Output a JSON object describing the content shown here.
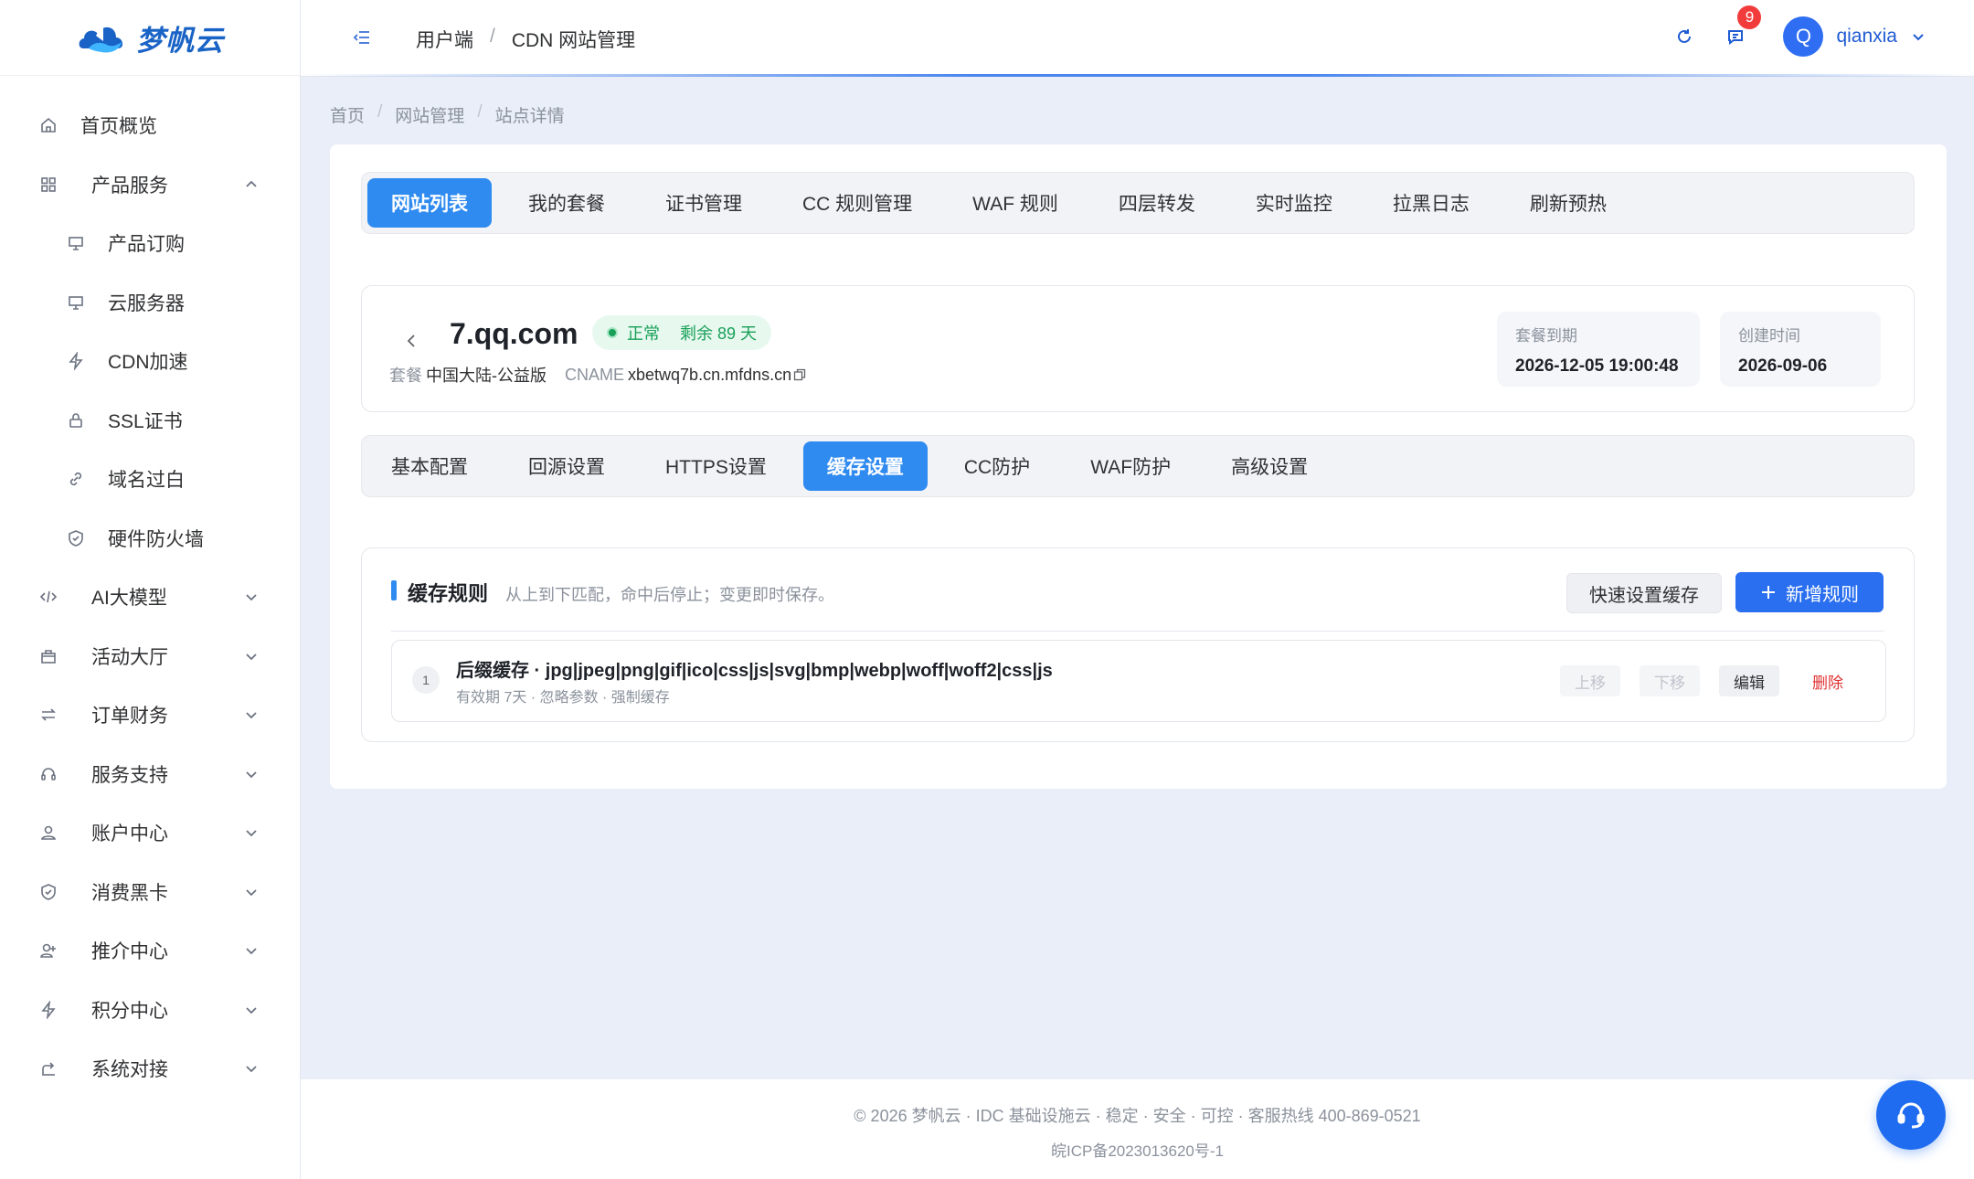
{
  "brand": {
    "logo_text": "梦帆云",
    "accent": "#2f8bf0"
  },
  "sidebar": {
    "items": [
      {
        "label": "首页概览",
        "icon": "home-icon",
        "expandable": false
      },
      {
        "label": "产品服务",
        "icon": "grid-icon",
        "expandable": true,
        "expanded": true
      },
      {
        "label": "产品订购",
        "icon": "monitor-icon",
        "sub": true
      },
      {
        "label": "云服务器",
        "icon": "monitor-icon",
        "sub": true
      },
      {
        "label": "CDN加速",
        "icon": "bolt-icon",
        "sub": true
      },
      {
        "label": "SSL证书",
        "icon": "lock-icon",
        "sub": true
      },
      {
        "label": "域名过白",
        "icon": "link-icon",
        "sub": true
      },
      {
        "label": "硬件防火墙",
        "icon": "shield-icon",
        "sub": true
      },
      {
        "label": "AI大模型",
        "icon": "code-icon",
        "expandable": true
      },
      {
        "label": "活动大厅",
        "icon": "gift-icon",
        "expandable": true
      },
      {
        "label": "订单财务",
        "icon": "swap-icon",
        "expandable": true
      },
      {
        "label": "服务支持",
        "icon": "headset-icon",
        "expandable": true
      },
      {
        "label": "账户中心",
        "icon": "user-icon",
        "expandable": true
      },
      {
        "label": "消费黑卡",
        "icon": "shield-check-icon",
        "expandable": true
      },
      {
        "label": "推介中心",
        "icon": "user-plus-icon",
        "expandable": true
      },
      {
        "label": "积分中心",
        "icon": "bolt-icon",
        "expandable": true
      },
      {
        "label": "系统对接",
        "icon": "share-icon",
        "expandable": true
      }
    ]
  },
  "header": {
    "crumb1": "用户端",
    "crumb_sep": "/",
    "crumb2": "CDN 网站管理",
    "notification_count": "9",
    "avatar_letter": "Q",
    "username": "qianxia"
  },
  "breadcrumb": {
    "home": "首页",
    "sep": "/",
    "site_mgmt": "网站管理",
    "detail": "站点详情"
  },
  "tabs": [
    "网站列表",
    "我的套餐",
    "证书管理",
    "CC 规则管理",
    "WAF 规则",
    "四层转发",
    "实时监控",
    "拉黑日志",
    "刷新预热"
  ],
  "site": {
    "domain": "7.qq.com",
    "status": "正常",
    "remaining": "剩余 89 天",
    "plan_label": "套餐",
    "plan_value": "中国大陆-公益版",
    "cname_label": "CNAME",
    "cname_value": "xbetwq7b.cn.mfdns.cn",
    "expire_label": "套餐到期",
    "expire_value": "2026-12-05 19:00:48",
    "created_label": "创建时间",
    "created_value": "2026-09-06"
  },
  "subtabs": [
    "基本配置",
    "回源设置",
    "HTTPS设置",
    "缓存设置",
    "CC防护",
    "WAF防护",
    "高级设置"
  ],
  "cache": {
    "title": "缓存规则",
    "subtitle": "从上到下匹配，命中后停止；变更即时保存。",
    "quick_btn": "快速设置缓存",
    "add_btn": "新增规则",
    "rules": [
      {
        "index": "1",
        "title": "后缀缓存 · jpg|jpeg|png|gif|ico|css|js|svg|bmp|webp|woff|woff2|css|js",
        "desc": "有效期 7天 · 忽略参数 · 强制缓存",
        "up": "上移",
        "down": "下移",
        "edit": "编辑",
        "delete": "删除"
      }
    ]
  },
  "footer": {
    "line1": "© 2026 梦帆云 · IDC 基础设施云 · 稳定 · 安全 · 可控 · 客服热线 400-869-0521",
    "line2": "皖ICP备2023013620号-1"
  }
}
